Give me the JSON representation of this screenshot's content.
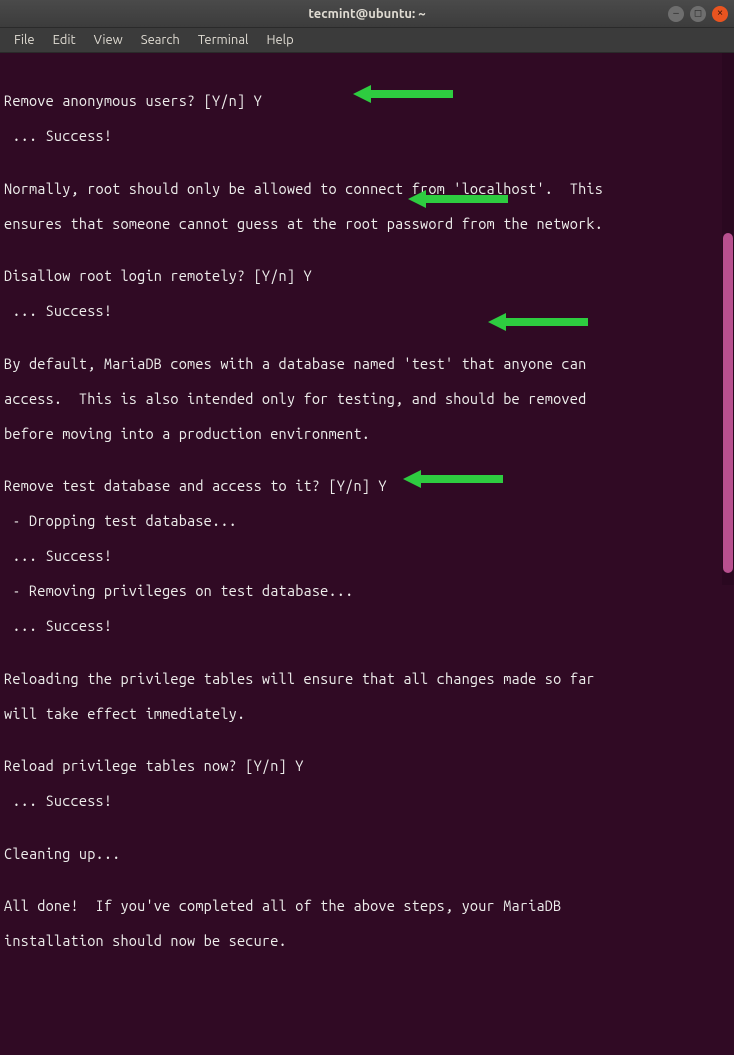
{
  "window": {
    "title": "tecmint@ubuntu: ~"
  },
  "menu": {
    "file": "File",
    "edit": "Edit",
    "view": "View",
    "search": "Search",
    "terminal": "Terminal",
    "help": "Help"
  },
  "lines": {
    "l0": "",
    "l1": "Remove anonymous users? [Y/n] Y",
    "l2": " ... Success!",
    "l3": "",
    "l4": "Normally, root should only be allowed to connect from 'localhost'.  This",
    "l5": "ensures that someone cannot guess at the root password from the network.",
    "l6": "",
    "l7": "Disallow root login remotely? [Y/n] Y",
    "l8": " ... Success!",
    "l9": "",
    "l10": "By default, MariaDB comes with a database named 'test' that anyone can",
    "l11": "access.  This is also intended only for testing, and should be removed",
    "l12": "before moving into a production environment.",
    "l13": "",
    "l14": "Remove test database and access to it? [Y/n] Y",
    "l15": " - Dropping test database...",
    "l16": " ... Success!",
    "l17": " - Removing privileges on test database...",
    "l18": " ... Success!",
    "l19": "",
    "l20": "Reloading the privilege tables will ensure that all changes made so far",
    "l21": "will take effect immediately.",
    "l22": "",
    "l23": "Reload privilege tables now? [Y/n] Y",
    "l24": " ... Success!",
    "l25": "",
    "l26": "Cleaning up...",
    "l27": "",
    "l28": "All done!  If you've completed all of the above steps, your MariaDB",
    "l29": "installation should now be secure."
  },
  "colors": {
    "arrow": "#2ecc40"
  }
}
